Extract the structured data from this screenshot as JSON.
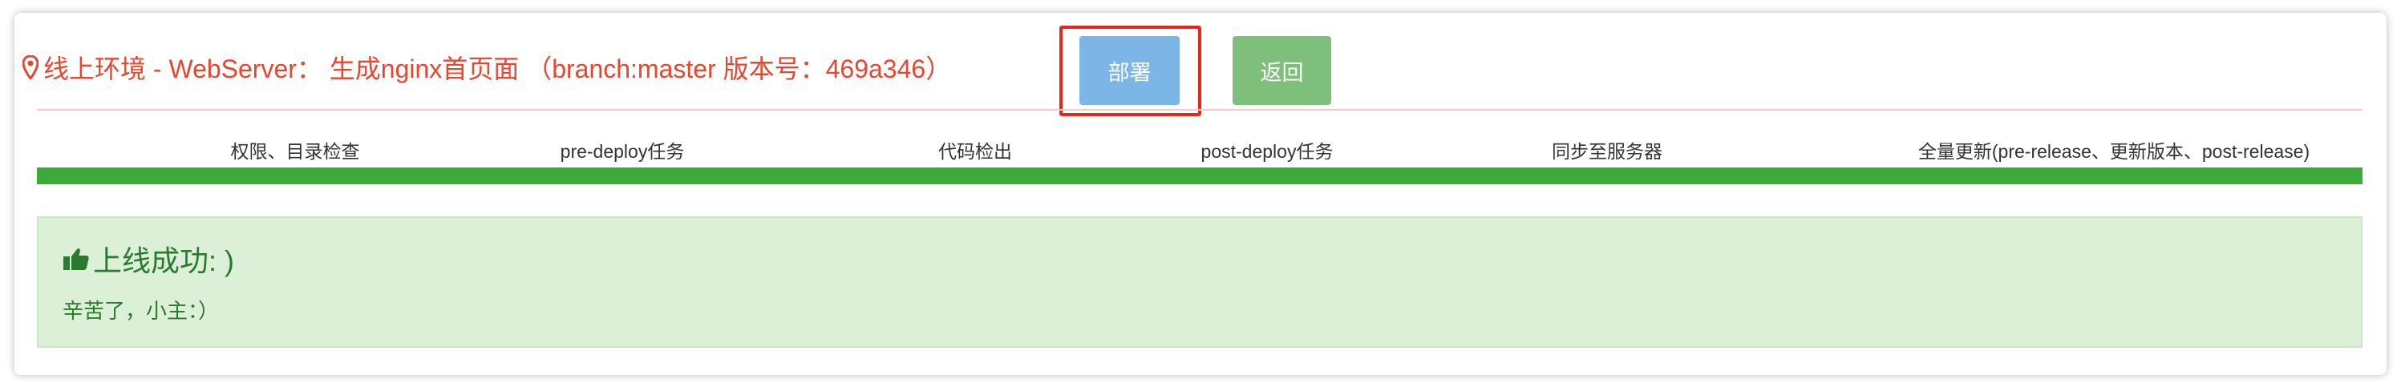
{
  "header": {
    "title": "线上环境 - WebServer： 生成nginx首页面 （branch:master 版本号：469a346）",
    "location_icon": "map-marker-icon"
  },
  "actions": {
    "deploy_label": "部署",
    "back_label": "返回"
  },
  "progress": {
    "steps": [
      "权限、目录检查",
      "pre-deploy任务",
      "代码检出",
      "post-deploy任务",
      "同步至服务器",
      "全量更新(pre-release、更新版本、post-release)"
    ],
    "percent": 100
  },
  "result": {
    "icon": "thumbs-up-icon",
    "title": "上线成功: )",
    "message": "辛苦了，小主：）"
  },
  "colors": {
    "title_red": "#e9452f",
    "deploy_blue": "#7cb6e6",
    "back_green": "#7dbf7b",
    "progress_green": "#3bab3c",
    "success_bg": "#dbf0d6",
    "success_text": "#2a7a2e",
    "highlight_red": "#e7271c"
  }
}
